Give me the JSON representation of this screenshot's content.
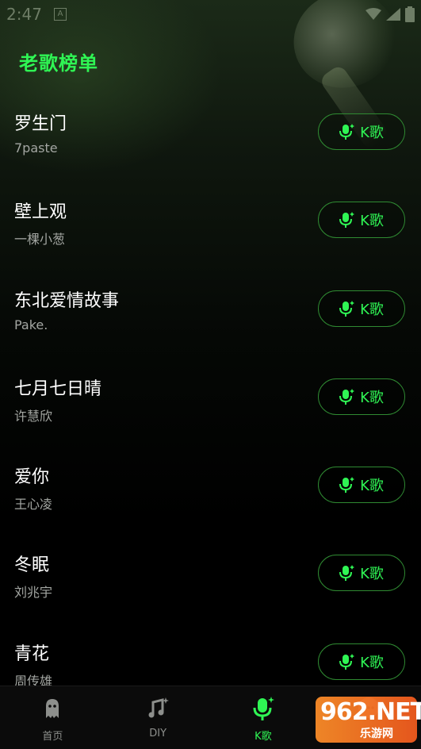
{
  "status_bar": {
    "time": "2:47",
    "a_badge": "A"
  },
  "page": {
    "title": "老歌榜单"
  },
  "k_button_label": "K歌",
  "songs": [
    {
      "title": "罗生门",
      "artist": "7paste"
    },
    {
      "title": "壁上观",
      "artist": "一棵小葱"
    },
    {
      "title": "东北爱情故事",
      "artist": "Pake."
    },
    {
      "title": "七月七日晴",
      "artist": "许慧欣"
    },
    {
      "title": "爱你",
      "artist": "王心凌"
    },
    {
      "title": "冬眠",
      "artist": "刘兆宇"
    },
    {
      "title": "青花",
      "artist": "周传雄"
    }
  ],
  "bottom_nav": [
    {
      "label": "首页",
      "icon": "ghost-icon",
      "active": false
    },
    {
      "label": "DIY",
      "icon": "music-note-icon",
      "active": false
    },
    {
      "label": "K歌",
      "icon": "microphone-icon",
      "active": true
    },
    {
      "label": "",
      "icon": "chat-icon",
      "active": false
    }
  ],
  "watermark": {
    "main": "962.NET",
    "sub": "乐游网"
  },
  "colors": {
    "accent": "#2ff554",
    "button_border": "#2f8a32",
    "text_primary": "#ffffff",
    "text_secondary": "#a3a6a2",
    "nav_inactive": "#8d8f8c"
  }
}
